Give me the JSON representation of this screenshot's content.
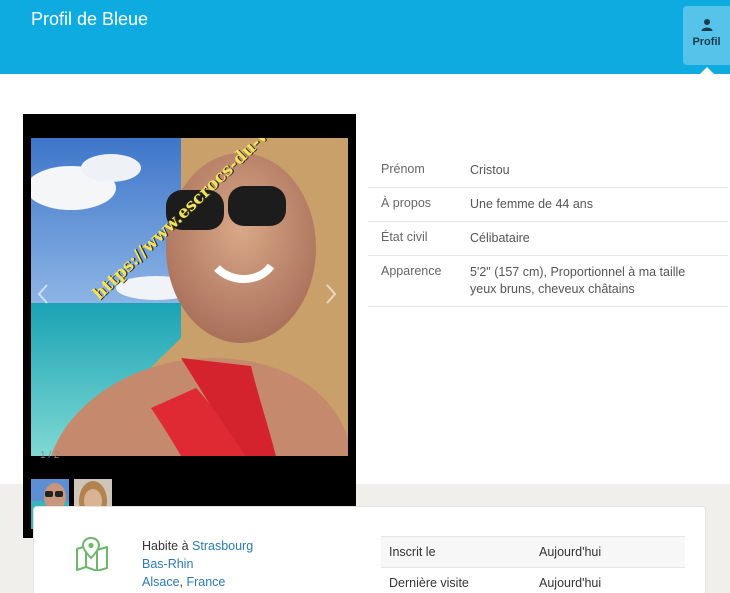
{
  "header": {
    "title": "Profil de Bleue",
    "tab_label": "Profil",
    "tab_icon": "user-icon",
    "color": "#0eabe0"
  },
  "gallery": {
    "counter": "1 / 2",
    "watermark": "https://www.escrocs-du-web.fr"
  },
  "details": {
    "rows": [
      {
        "label": "Prénom",
        "value": "Cristou"
      },
      {
        "label": "À propos",
        "value": "Une femme de 44 ans"
      },
      {
        "label": "État civil",
        "value": "Célibataire"
      },
      {
        "label": "Apparence",
        "value_line1": "5'2\" (157 cm), Proportionnel à ma taille",
        "value_line2": "yeux bruns, cheveux châtains"
      }
    ]
  },
  "location": {
    "icon": "map-icon",
    "lives_prefix": "Habite à ",
    "city": "Strasbourg",
    "department": "Bas-Rhin",
    "region": "Alsace",
    "separator": ", ",
    "country": "France"
  },
  "stats": {
    "rows": [
      {
        "label": "Inscrit le",
        "value": "Aujourd'hui"
      },
      {
        "label": "Dernière visite",
        "value": "Aujourd'hui"
      }
    ]
  }
}
